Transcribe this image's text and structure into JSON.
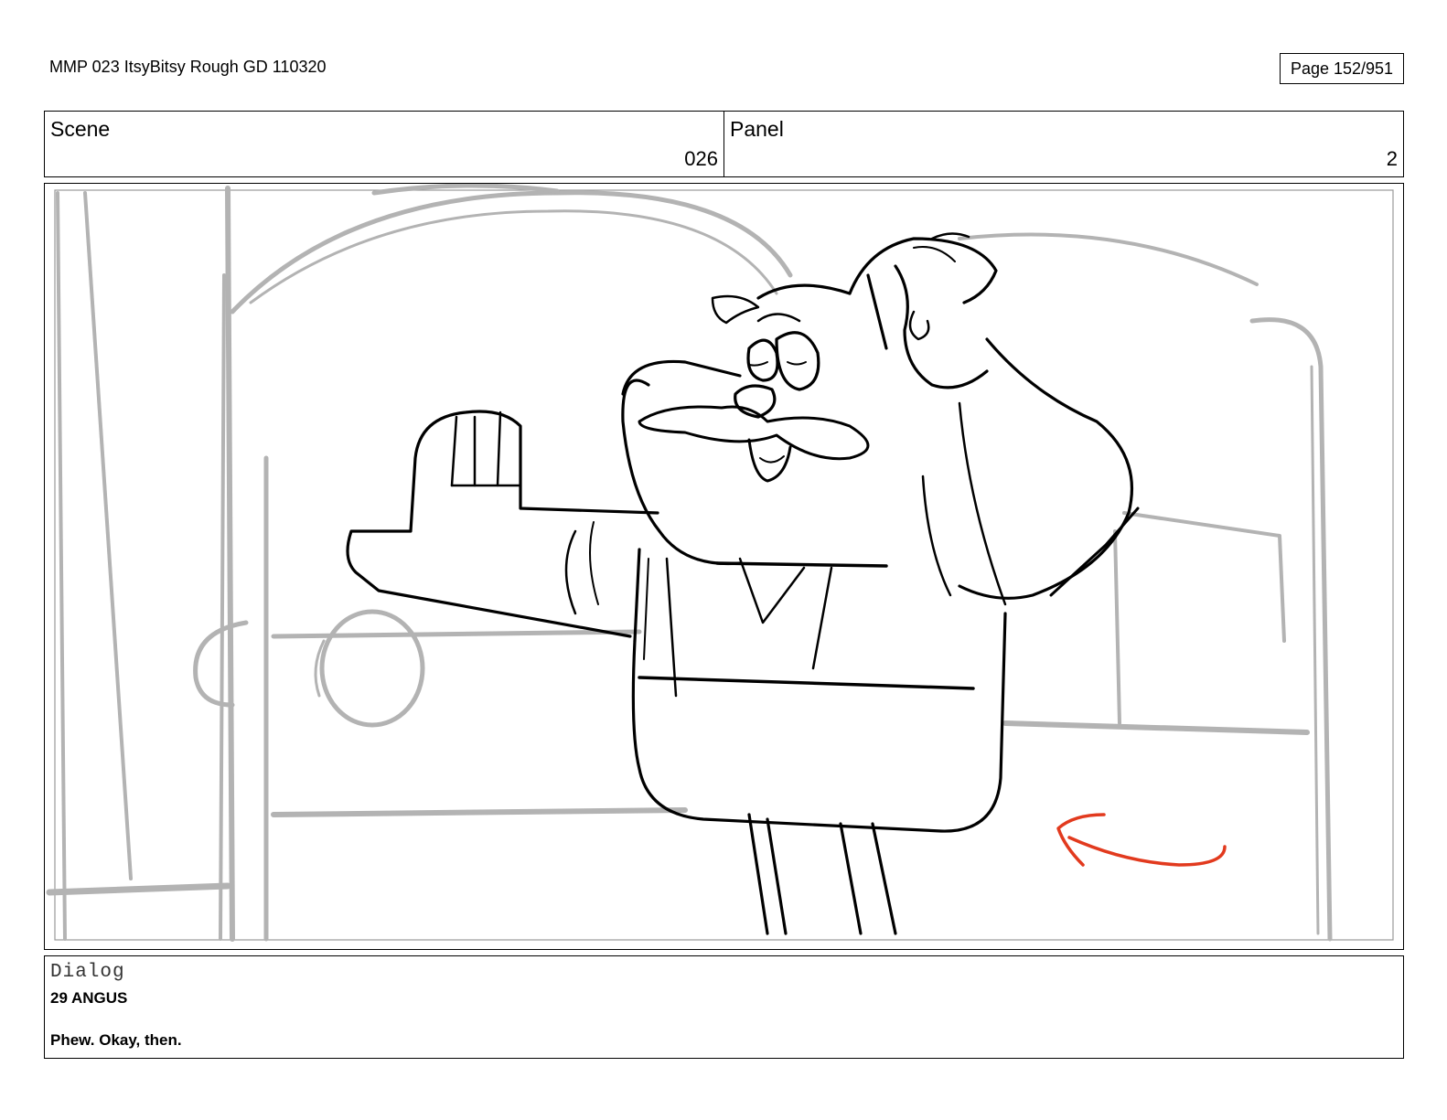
{
  "document": {
    "title": "MMP 023 ItsyBitsy Rough GD 110320",
    "page": "Page 152/951"
  },
  "header": {
    "scene_label": "Scene",
    "scene_value": "026",
    "panel_label": "Panel",
    "panel_value": "2"
  },
  "dialog": {
    "label": "Dialog",
    "speaker": "29 ANGUS",
    "line": "Phew. Okay, then."
  },
  "colors": {
    "background_sketch": "#b3b3b3",
    "character_lines": "#000000",
    "motion_arrow": "#e23a1e"
  }
}
